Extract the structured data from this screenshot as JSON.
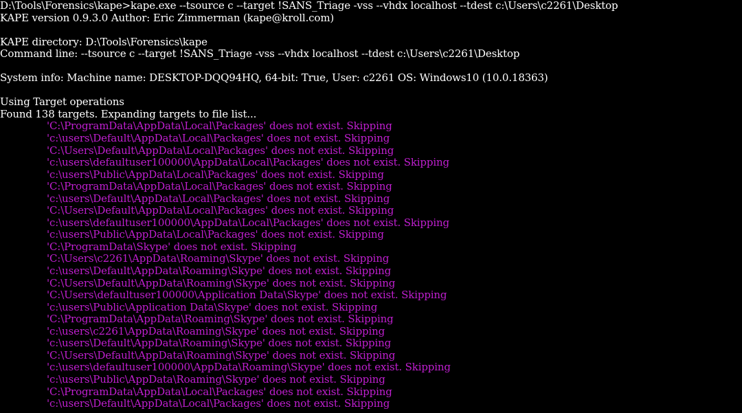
{
  "header_lines": [
    "D:\\Tools\\Forensics\\kape>kape.exe --tsource c --target !SANS_Triage -vss --vhdx localhost --tdest c:\\Users\\c2261\\Desktop",
    "KAPE version 0.9.3.0 Author: Eric Zimmerman (kape@kroll.com)",
    "",
    "KAPE directory: D:\\Tools\\Forensics\\kape",
    "Command line: --tsource c --target !SANS_Triage -vss --vhdx localhost --tdest c:\\Users\\c2261\\Desktop",
    "",
    "System info: Machine name: DESKTOP-DQQ94HQ, 64-bit: True, User: c2261 OS: Windows10 (10.0.18363)",
    "",
    "Using Target operations",
    "Found 138 targets. Expanding targets to file list..."
  ],
  "skip_lines": [
    "'C:\\ProgramData\\AppData\\Local\\Packages' does not exist. Skipping",
    "'c:\\users\\Default\\AppData\\Local\\Packages' does not exist. Skipping",
    "'C:\\Users\\Default\\AppData\\Local\\Packages' does not exist. Skipping",
    "'c:\\users\\defaultuser100000\\AppData\\Local\\Packages' does not exist. Skipping",
    "'c:\\users\\Public\\AppData\\Local\\Packages' does not exist. Skipping",
    "'C:\\ProgramData\\AppData\\Local\\Packages' does not exist. Skipping",
    "'c:\\users\\Default\\AppData\\Local\\Packages' does not exist. Skipping",
    "'C:\\Users\\Default\\AppData\\Local\\Packages' does not exist. Skipping",
    "'c:\\users\\defaultuser100000\\AppData\\Local\\Packages' does not exist. Skipping",
    "'c:\\users\\Public\\AppData\\Local\\Packages' does not exist. Skipping",
    "'C:\\ProgramData\\Skype' does not exist. Skipping",
    "'C:\\Users\\c2261\\AppData\\Roaming\\Skype' does not exist. Skipping",
    "'c:\\users\\Default\\AppData\\Roaming\\Skype' does not exist. Skipping",
    "'C:\\Users\\Default\\AppData\\Roaming\\Skype' does not exist. Skipping",
    "'C:\\Users\\defaultuser100000\\Application Data\\Skype' does not exist. Skipping",
    "'c:\\users\\Public\\Application Data\\Skype' does not exist. Skipping",
    "'C:\\ProgramData\\AppData\\Roaming\\Skype' does not exist. Skipping",
    "'c:\\users\\c2261\\AppData\\Roaming\\Skype' does not exist. Skipping",
    "'c:\\users\\Default\\AppData\\Roaming\\Skype' does not exist. Skipping",
    "'C:\\Users\\Default\\AppData\\Roaming\\Skype' does not exist. Skipping",
    "'c:\\users\\defaultuser100000\\AppData\\Roaming\\Skype' does not exist. Skipping",
    "'c:\\users\\Public\\AppData\\Roaming\\Skype' does not exist. Skipping",
    "'C:\\ProgramData\\AppData\\Local\\Packages' does not exist. Skipping",
    "'c:\\users\\Default\\AppData\\Local\\Packages' does not exist. Skipping"
  ],
  "colors": {
    "background": "#000000",
    "text": "#ffffff",
    "skip_text": "#c01fd0"
  }
}
